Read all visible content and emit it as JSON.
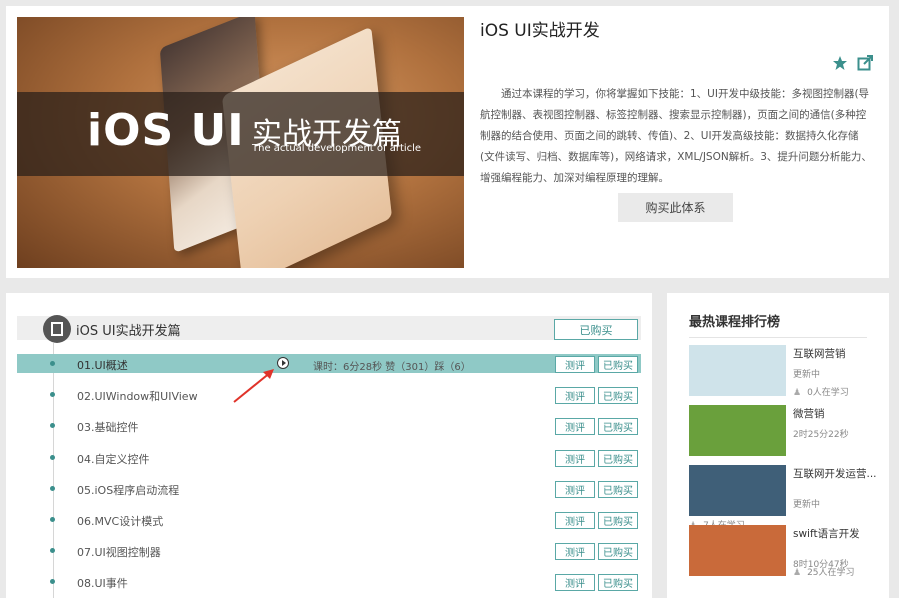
{
  "course": {
    "title": "iOS UI实战开发",
    "banner": {
      "big_text": "iOS UI",
      "cn_text": "实战开发篇",
      "sub_text": "The actual development of article"
    },
    "description": "通过本课程的学习，你将掌握如下技能：1、UI开发中级技能：多视图控制器(导航控制器、表视图控制器、标签控制器、搜索显示控制器)，页面之间的通信(多种控制器的结合使用、页面之间的跳转、传值)、2、UI开发高级技能：数据持久化存储(文件读写、归档、数据库等)，网络请求，XML/JSON解析。3、提升问题分析能力、增强编程能力、加深对编程原理的理解。",
    "buy_system_label": "购买此体系",
    "icons": [
      "star-icon",
      "share-icon"
    ],
    "accent_color": "#3b8f8c"
  },
  "chapter": {
    "title": "iOS UI实战开发篇",
    "bought_label": "已购买",
    "lessons": [
      {
        "name": "01.UI概述",
        "active": true,
        "meta": "课时：6分28秒     赞（301）踩（6）",
        "test": "测评",
        "buy": "已购买"
      },
      {
        "name": "02.UIWindow和UIView",
        "test": "测评",
        "buy": "已购买"
      },
      {
        "name": "03.基础控件",
        "test": "测评",
        "buy": "已购买"
      },
      {
        "name": "04.自定义控件",
        "test": "测评",
        "buy": "已购买"
      },
      {
        "name": "05.iOS程序启动流程",
        "test": "测评",
        "buy": "已购买"
      },
      {
        "name": "06.MVC设计模式",
        "test": "测评",
        "buy": "已购买"
      },
      {
        "name": "07.UI视图控制器",
        "test": "测评",
        "buy": "已购买"
      },
      {
        "name": "08.UI事件",
        "test": "测评",
        "buy": "已购买"
      }
    ]
  },
  "ranking": {
    "title": "最热课程排行榜",
    "items": [
      {
        "name": "互联网营销",
        "sub": "更新中",
        "count": "0人在学习",
        "thumb_color": "#cfe3ea"
      },
      {
        "name": "微营销",
        "sub": "2时25分22秒",
        "count": "",
        "thumb_color": "#6aa03c"
      },
      {
        "name": "互联网开发运营...",
        "sub": "更新中",
        "count": "7人在学习",
        "thumb_color": "#3f5f78"
      },
      {
        "name": "swift语言开发",
        "sub": "8时10分47秒",
        "count": "25人在学习",
        "thumb_color": "#c96a3a"
      }
    ]
  }
}
